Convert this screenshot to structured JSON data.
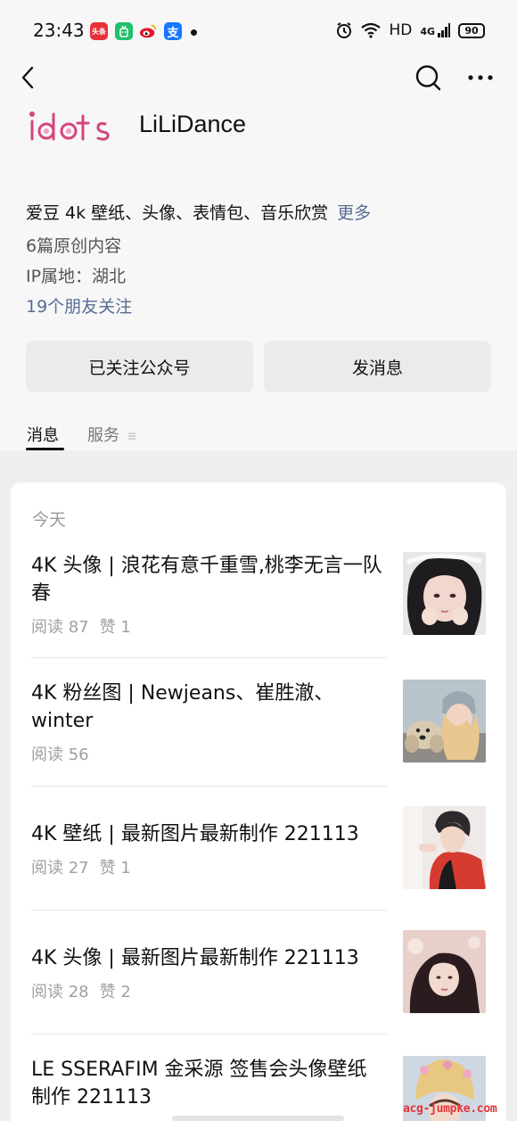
{
  "status_bar": {
    "time": "23:43",
    "apps": [
      {
        "icon": "toutiao-icon",
        "label": "头条",
        "color": "#e8303a"
      },
      {
        "icon": "app-green-icon",
        "label": "",
        "color": "#21c06b"
      },
      {
        "icon": "weibo-icon",
        "label": "",
        "color": "#f7b500"
      },
      {
        "icon": "alipay-icon",
        "label": "支",
        "color": "#1677ff"
      }
    ],
    "network": "HD",
    "signal": "4G",
    "battery": "90"
  },
  "nav": {
    "back_icon": "chevron-left-icon",
    "search_icon": "search-icon",
    "more_icon": "more-horizontal-icon"
  },
  "profile": {
    "logo_text": "idols",
    "name": "LiLiDance",
    "bio": "爱豆 4k 壁纸、头像、表情包、音乐欣赏",
    "bio_more": "更多",
    "original_count": "6篇原创内容",
    "ip_location": "IP属地：湖北",
    "friends_following": "19个朋友关注"
  },
  "actions": {
    "followed_label": "已关注公众号",
    "message_label": "发消息"
  },
  "tabs": {
    "messages": "消息",
    "services": "服务",
    "services_icon": "menu-icon"
  },
  "feed": {
    "date_header": "今天",
    "articles": [
      {
        "title": "4K 头像 | 浪花有意千重雪,桃李无言一队春",
        "reads": "阅读 87",
        "likes": "赞 1"
      },
      {
        "title": "4K 粉丝图 | Newjeans、崔胜澈、winter",
        "reads": "阅读 56",
        "likes": ""
      },
      {
        "title": "4K 壁纸 | 最新图片最新制作 221113",
        "reads": "阅读 27",
        "likes": "赞 1"
      },
      {
        "title": "4K 头像 | 最新图片最新制作 221113",
        "reads": "阅读 28",
        "likes": "赞 2"
      },
      {
        "title": "LE SSERAFIM 金采源 签售会头像壁纸制作 221113",
        "reads": "",
        "likes": ""
      }
    ]
  },
  "watermark": "acg-jumpke.com"
}
